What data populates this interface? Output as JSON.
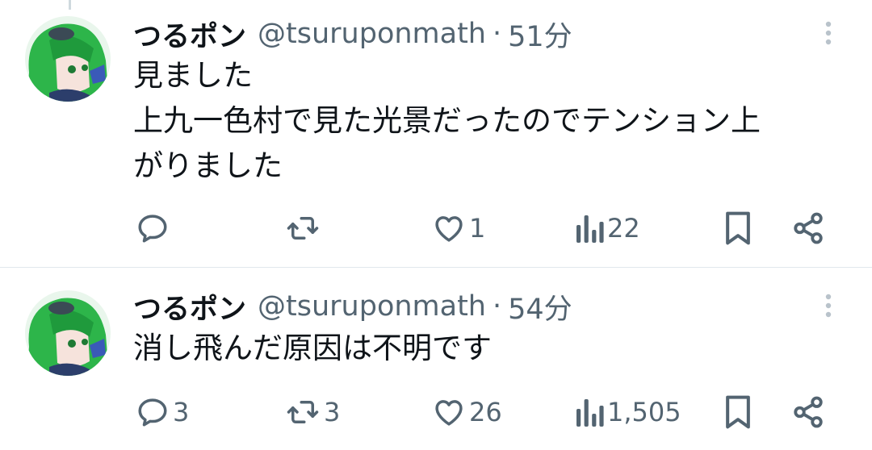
{
  "tweets": [
    {
      "display_name": "つるポン",
      "handle": "@tsuruponmath",
      "separator": "·",
      "time": "51分",
      "lines": [
        "見ました",
        "上九一色村で見た光景だったのでテンション上",
        "がりました"
      ],
      "replies": "",
      "retweets": "",
      "likes": "1",
      "views": "22"
    },
    {
      "display_name": "つるポン",
      "handle": "@tsuruponmath",
      "separator": "·",
      "time": "54分",
      "lines": [
        "消し飛んだ原因は不明です"
      ],
      "replies": "3",
      "retweets": "3",
      "likes": "26",
      "views": "1,505"
    }
  ],
  "icons": {
    "reply": "reply-icon",
    "retweet": "retweet-icon",
    "like": "heart-icon",
    "views": "views-icon",
    "bookmark": "bookmark-icon",
    "share": "share-icon",
    "more": "more-vertical-icon"
  },
  "colors": {
    "text_primary": "#0f1419",
    "text_secondary": "#536471",
    "divider": "#e1e8ed",
    "avatar_hair": "#2db54a"
  }
}
